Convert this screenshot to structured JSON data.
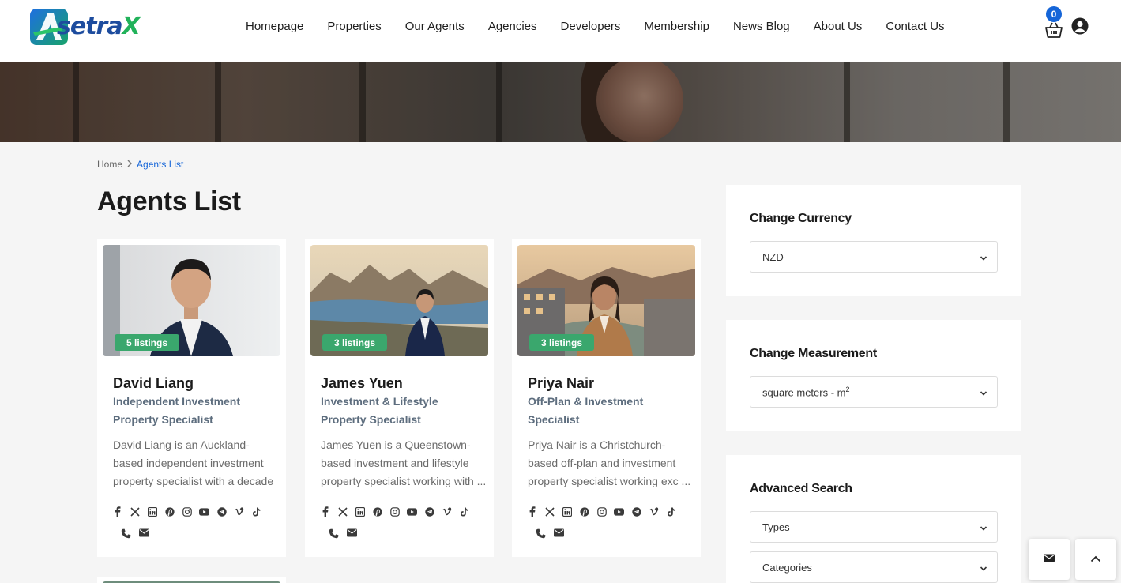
{
  "brand": {
    "name_left": "setra",
    "name_x": "X",
    "logo_letter": "A"
  },
  "nav": {
    "items": [
      "Homepage",
      "Properties",
      "Our Agents",
      "Agencies",
      "Developers",
      "Membership",
      "News Blog",
      "About Us",
      "Contact Us"
    ]
  },
  "cart": {
    "count": "0"
  },
  "breadcrumb": {
    "home": "Home",
    "current": "Agents List"
  },
  "page": {
    "title": "Agents List"
  },
  "agents": [
    {
      "listings": "5 listings",
      "name": "David Liang",
      "role": "Independent Investment Property Specialist",
      "description": "David Liang is an Auckland-based independent investment property specialist with a decade ..."
    },
    {
      "listings": "3 listings",
      "name": "James Yuen",
      "role": "Investment & Lifestyle Property Specialist",
      "description": "James Yuen is a Queenstown-based investment and lifestyle property specialist working with ..."
    },
    {
      "listings": "3 listings",
      "name": "Priya Nair",
      "role": "Off-Plan & Investment Specialist",
      "description": "Priya Nair is a Christchurch-based off-plan and investment property specialist working exc ..."
    }
  ],
  "social_icons": [
    "facebook-icon",
    "x-icon",
    "linkedin-icon",
    "pinterest-icon",
    "instagram-icon",
    "youtube-icon",
    "telegram-icon",
    "vimeo-icon",
    "tiktok-icon"
  ],
  "sidebar": {
    "currency": {
      "title": "Change Currency",
      "value": "NZD"
    },
    "measurement": {
      "title": "Change Measurement",
      "value": "square meters - m",
      "sup": "2"
    },
    "advanced": {
      "title": "Advanced Search",
      "types": "Types",
      "categories": "Categories"
    }
  },
  "colors": {
    "accent": "#1565d8",
    "badge": "#3aa76d",
    "brand_green": "#21b25a",
    "brand_blue": "#1d4c9e"
  }
}
